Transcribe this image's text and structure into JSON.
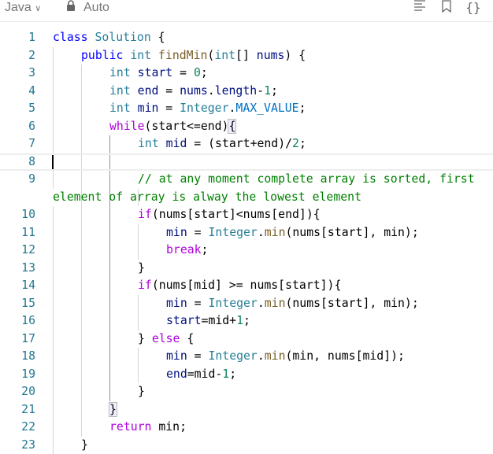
{
  "header": {
    "language": "Java",
    "mode": "Auto",
    "icons": [
      "format-icon",
      "bookmark-icon",
      "braces-icon"
    ]
  },
  "colors": {
    "keyword": "#0000ff",
    "type": "#267f99",
    "function": "#795e26",
    "variable": "#001080",
    "number": "#098658",
    "control": "#af00db",
    "comment": "#008000"
  },
  "active_line": 8,
  "lines": [
    {
      "n": "1",
      "indent": 0,
      "tokens": [
        [
          "k",
          "class"
        ],
        [
          "p",
          " "
        ],
        [
          "t",
          "Solution"
        ],
        [
          "p",
          " {"
        ]
      ]
    },
    {
      "n": "2",
      "indent": 1,
      "tokens": [
        [
          "k",
          "public"
        ],
        [
          "p",
          " "
        ],
        [
          "t",
          "int"
        ],
        [
          "p",
          " "
        ],
        [
          "f",
          "findMin"
        ],
        [
          "p",
          "("
        ],
        [
          "t",
          "int"
        ],
        [
          "p",
          "[] "
        ],
        [
          "v",
          "nums"
        ],
        [
          "p",
          ") {"
        ]
      ]
    },
    {
      "n": "3",
      "indent": 2,
      "tokens": [
        [
          "t",
          "int"
        ],
        [
          "p",
          " "
        ],
        [
          "v",
          "start"
        ],
        [
          "p",
          " = "
        ],
        [
          "n",
          "0"
        ],
        [
          "p",
          ";"
        ]
      ]
    },
    {
      "n": "4",
      "indent": 2,
      "tokens": [
        [
          "t",
          "int"
        ],
        [
          "p",
          " "
        ],
        [
          "v",
          "end"
        ],
        [
          "p",
          " = "
        ],
        [
          "v",
          "nums"
        ],
        [
          "p",
          "."
        ],
        [
          "v",
          "length"
        ],
        [
          "p",
          "-"
        ],
        [
          "n",
          "1"
        ],
        [
          "p",
          ";"
        ]
      ]
    },
    {
      "n": "5",
      "indent": 2,
      "tokens": [
        [
          "t",
          "int"
        ],
        [
          "p",
          " "
        ],
        [
          "v",
          "min"
        ],
        [
          "p",
          " = "
        ],
        [
          "t",
          "Integer"
        ],
        [
          "p",
          "."
        ],
        [
          "o",
          "MAX_VALUE"
        ],
        [
          "p",
          ";"
        ]
      ]
    },
    {
      "n": "6",
      "indent": 2,
      "tokens": [
        [
          "c",
          "while"
        ],
        [
          "p",
          "(start<=end)"
        ],
        [
          "bm",
          "{"
        ]
      ]
    },
    {
      "n": "7",
      "indent": 3,
      "tokens": [
        [
          "t",
          "int"
        ],
        [
          "p",
          " "
        ],
        [
          "v",
          "mid"
        ],
        [
          "p",
          " = (start+end)/"
        ],
        [
          "n",
          "2"
        ],
        [
          "p",
          ";"
        ]
      ]
    },
    {
      "n": "8",
      "indent": 0,
      "tokens": []
    },
    {
      "n": "9",
      "indent": 3,
      "tokens": [
        [
          "m",
          "// at any moment complete array is sorted, first"
        ]
      ]
    },
    {
      "n": "",
      "indent": 0,
      "tokens": [
        [
          "m",
          "element of array is alway the lowest element"
        ]
      ]
    },
    {
      "n": "10",
      "indent": 3,
      "tokens": [
        [
          "c",
          "if"
        ],
        [
          "p",
          "(nums[start]<nums[end]){"
        ]
      ]
    },
    {
      "n": "11",
      "indent": 4,
      "tokens": [
        [
          "v",
          "min"
        ],
        [
          "p",
          " = "
        ],
        [
          "t",
          "Integer"
        ],
        [
          "p",
          "."
        ],
        [
          "f",
          "min"
        ],
        [
          "p",
          "(nums[start], min);"
        ]
      ]
    },
    {
      "n": "12",
      "indent": 4,
      "tokens": [
        [
          "c",
          "break"
        ],
        [
          "p",
          ";"
        ]
      ]
    },
    {
      "n": "13",
      "indent": 3,
      "tokens": [
        [
          "p",
          "}"
        ]
      ]
    },
    {
      "n": "14",
      "indent": 3,
      "tokens": [
        [
          "c",
          "if"
        ],
        [
          "p",
          "(nums[mid] >= nums[start]){"
        ]
      ]
    },
    {
      "n": "15",
      "indent": 4,
      "tokens": [
        [
          "v",
          "min"
        ],
        [
          "p",
          " = "
        ],
        [
          "t",
          "Integer"
        ],
        [
          "p",
          "."
        ],
        [
          "f",
          "min"
        ],
        [
          "p",
          "(nums[start], min);"
        ]
      ]
    },
    {
      "n": "16",
      "indent": 4,
      "tokens": [
        [
          "v",
          "start"
        ],
        [
          "p",
          "=mid+"
        ],
        [
          "n",
          "1"
        ],
        [
          "p",
          ";"
        ]
      ]
    },
    {
      "n": "17",
      "indent": 3,
      "tokens": [
        [
          "p",
          "} "
        ],
        [
          "c",
          "else"
        ],
        [
          "p",
          " {"
        ]
      ]
    },
    {
      "n": "18",
      "indent": 4,
      "tokens": [
        [
          "v",
          "min"
        ],
        [
          "p",
          " = "
        ],
        [
          "t",
          "Integer"
        ],
        [
          "p",
          "."
        ],
        [
          "f",
          "min"
        ],
        [
          "p",
          "(min, nums[mid]);"
        ]
      ]
    },
    {
      "n": "19",
      "indent": 4,
      "tokens": [
        [
          "v",
          "end"
        ],
        [
          "p",
          "=mid-"
        ],
        [
          "n",
          "1"
        ],
        [
          "p",
          ";"
        ]
      ]
    },
    {
      "n": "20",
      "indent": 3,
      "tokens": [
        [
          "p",
          "}"
        ]
      ]
    },
    {
      "n": "21",
      "indent": 2,
      "tokens": [
        [
          "bm",
          "}"
        ]
      ]
    },
    {
      "n": "22",
      "indent": 2,
      "tokens": [
        [
          "c",
          "return"
        ],
        [
          "p",
          " min;"
        ]
      ]
    },
    {
      "n": "23",
      "indent": 1,
      "tokens": [
        [
          "p",
          "}"
        ]
      ]
    }
  ]
}
